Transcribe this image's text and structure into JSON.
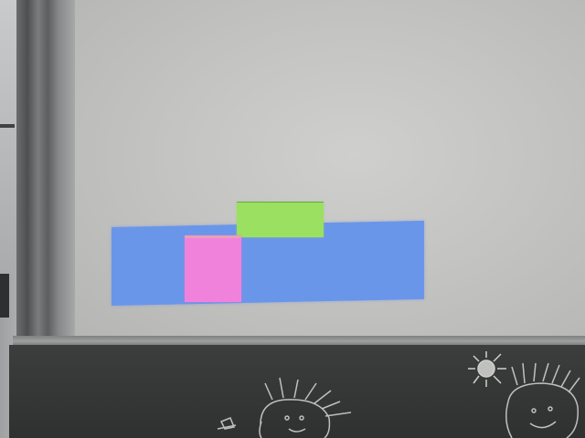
{
  "scene": {
    "description_colors": {
      "projection_surface": "#c8c8c6",
      "blue_block": "#6a96ea",
      "pink_block": "#f082dc",
      "green_block": "#9be060",
      "chalkboard": "#333535"
    },
    "chalk_drawings": [
      "face-drawing",
      "sun-drawing",
      "face-drawing-right"
    ]
  }
}
